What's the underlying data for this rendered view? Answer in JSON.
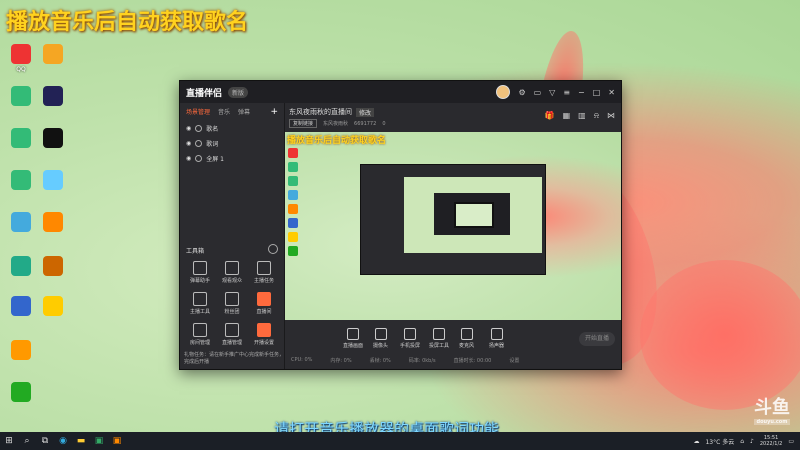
{
  "overlay": {
    "title": "播放音乐后自动获取歌名",
    "subtitle": "请打开音乐播放器的桌面歌词功能"
  },
  "app": {
    "logo": "直播伴侣",
    "version": "新版",
    "room_title": "东风夜雨秋的直播间",
    "room_tag": "修改",
    "room_btn": "复制链接",
    "room_id": "东风夜雨秋",
    "room_num": "6691772",
    "likes": "0",
    "tabs": [
      "场景管理",
      "音乐",
      "弹幕"
    ],
    "scenes": [
      "歌名",
      "歌词",
      "全屏 1"
    ],
    "toolbox_label": "工具箱",
    "tools": [
      {
        "label": "弹幕助手",
        "icon": "image-icon"
      },
      {
        "label": "观看观众",
        "icon": "user-icon"
      },
      {
        "label": "主播任务",
        "icon": "clipboard-icon"
      },
      {
        "label": "主播工具",
        "icon": "chat-icon"
      },
      {
        "label": "粉丝团",
        "icon": "download-icon"
      },
      {
        "label": "直播间",
        "icon": "briefcase-icon",
        "accent": true
      },
      {
        "label": "房间管理",
        "icon": "calendar-icon"
      },
      {
        "label": "直播管理",
        "icon": "calendar-icon"
      },
      {
        "label": "开播设置",
        "icon": "gift-icon",
        "accent": true
      }
    ],
    "notice": "礼物任务：请在新手推广中心完成新手任务，完成后开播",
    "controls": [
      "直播画面",
      "摄像头",
      "手机投屏",
      "投屏工具",
      "麦克风",
      "扬声器"
    ],
    "start_label": "开始直播",
    "status": [
      "CPU: 0%",
      "内存: 0%",
      "丢帧: 0%",
      "码率: 0kb/s",
      "直播时长: 00:00",
      "设置"
    ]
  },
  "watermark": {
    "text": "斗鱼",
    "sub": "douyu.com"
  },
  "taskbar": {
    "weather": "13°C 多云",
    "time": "15:51",
    "date": "2022/1/2"
  },
  "colors": {
    "overlay_text": "#ffd21f",
    "subtitle": "#7fd8ff",
    "accent": "#ff6a3d"
  }
}
